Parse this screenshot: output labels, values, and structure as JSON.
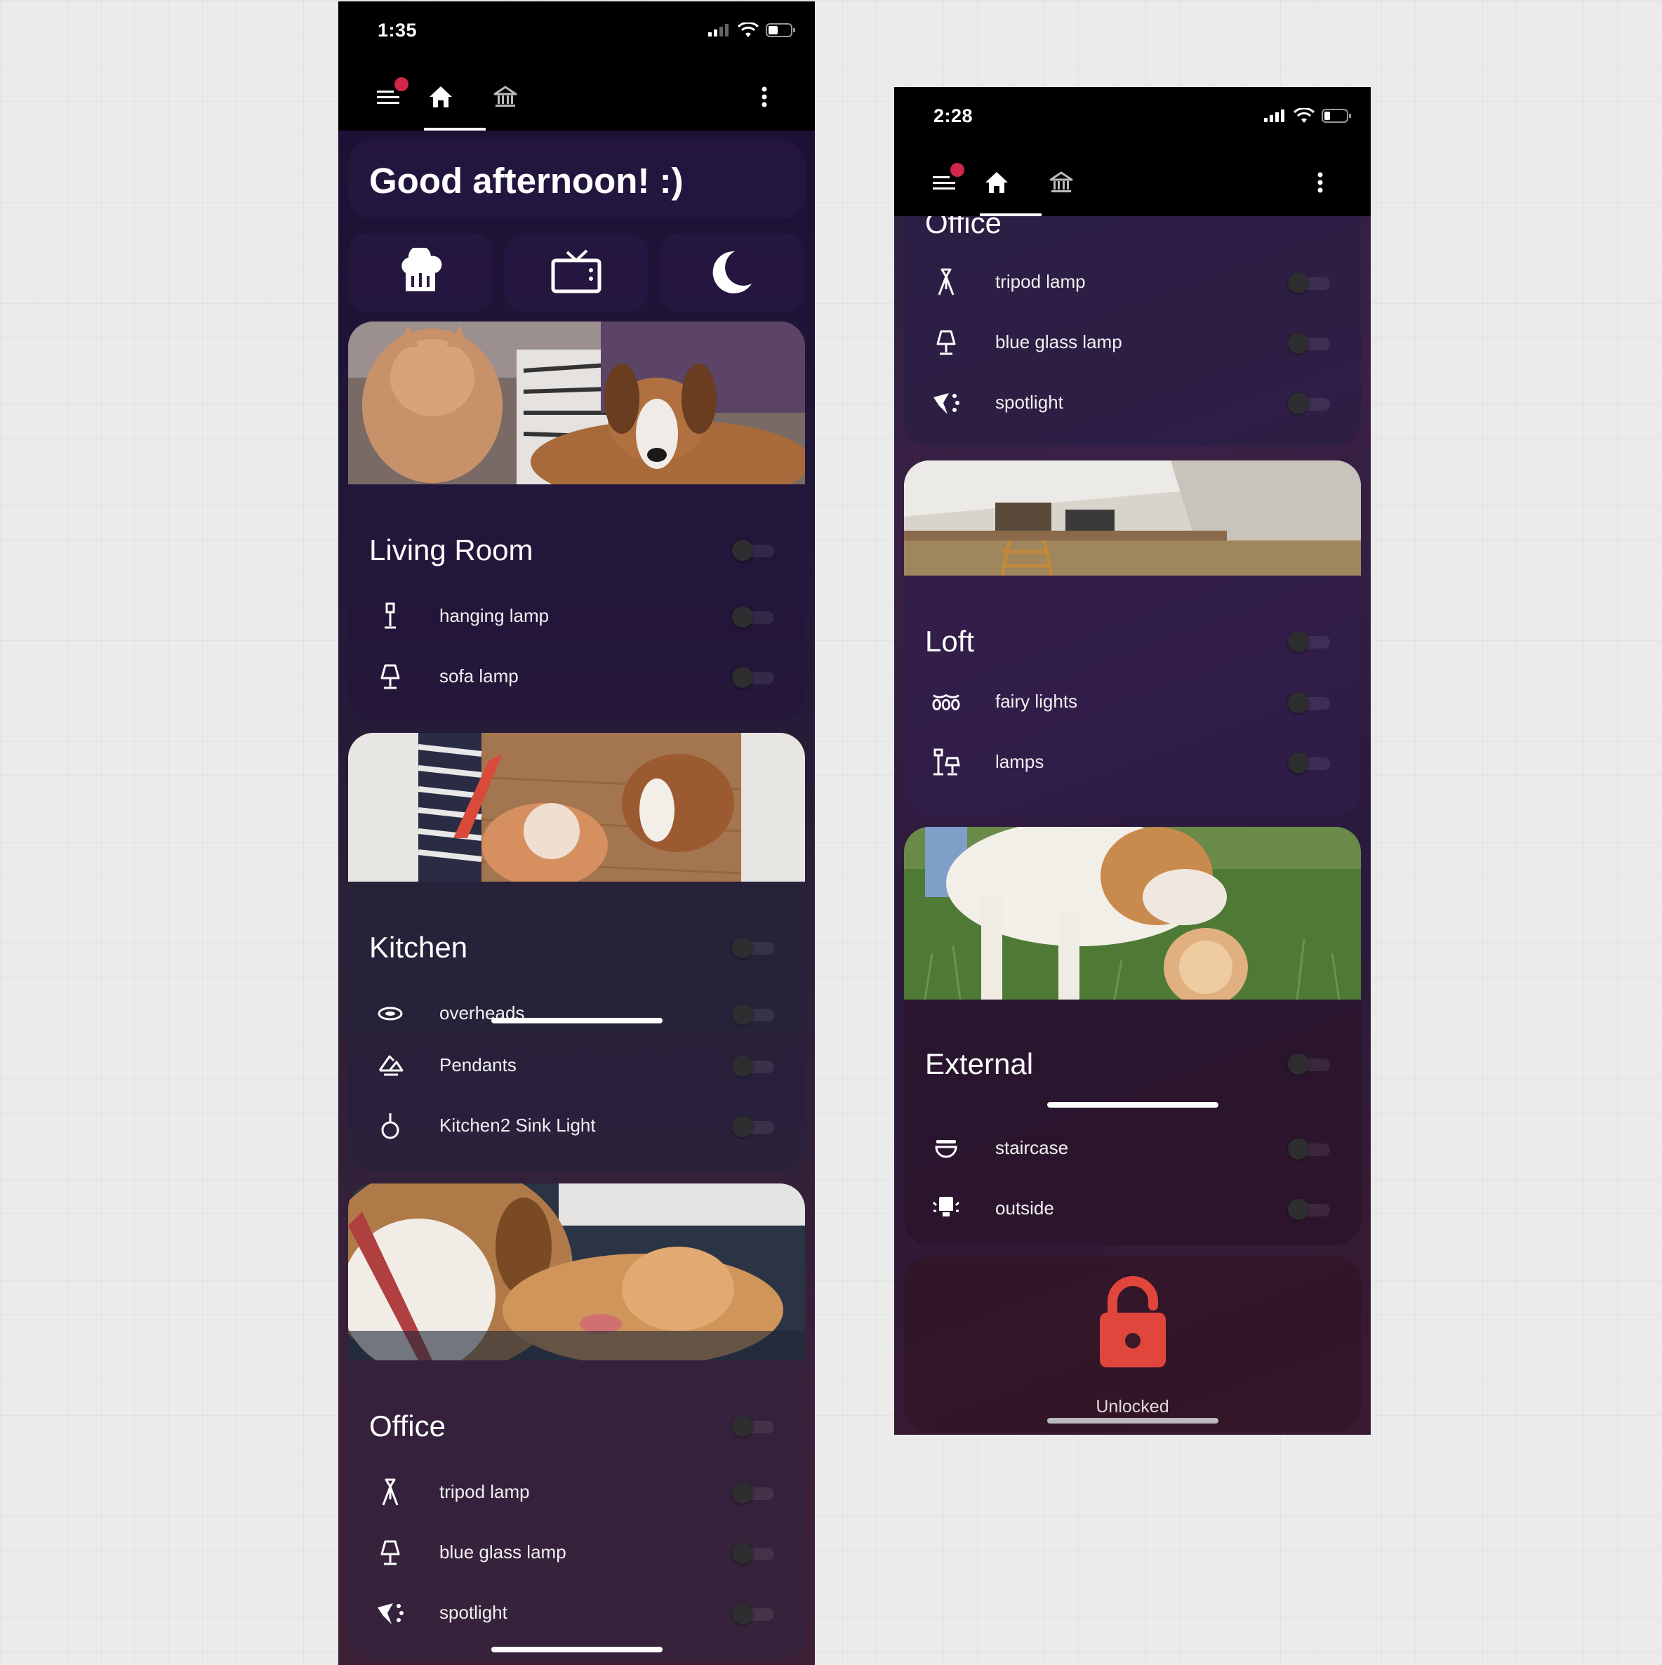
{
  "phone1": {
    "status": {
      "time": "1:35"
    },
    "greeting": "Good afternoon! :)",
    "scenes": [
      {
        "icon": "chef-hat-icon"
      },
      {
        "icon": "tv-icon"
      },
      {
        "icon": "moon-icon"
      }
    ],
    "rooms": [
      {
        "title": "Living Room",
        "items": [
          {
            "label": "hanging lamp",
            "icon": "hanging-lamp-icon"
          },
          {
            "label": "sofa lamp",
            "icon": "table-lamp-icon"
          }
        ]
      },
      {
        "title": "Kitchen",
        "items": [
          {
            "label": "overheads",
            "icon": "ceiling-light-icon"
          },
          {
            "label": "Pendants",
            "icon": "pendant-light-icon"
          },
          {
            "label": "Kitchen2 Sink Light",
            "icon": "ceiling-fixture-icon"
          }
        ]
      },
      {
        "title": "Office",
        "items": [
          {
            "label": "tripod lamp",
            "icon": "tripod-lamp-icon"
          },
          {
            "label": "blue glass lamp",
            "icon": "table-lamp-icon"
          },
          {
            "label": "spotlight",
            "icon": "spotlight-icon"
          }
        ]
      }
    ]
  },
  "phone2": {
    "status": {
      "time": "2:28"
    },
    "office_partial": {
      "title": "Office",
      "items": [
        {
          "label": "tripod lamp",
          "icon": "tripod-lamp-icon"
        },
        {
          "label": "blue glass lamp",
          "icon": "table-lamp-icon"
        },
        {
          "label": "spotlight",
          "icon": "spotlight-icon"
        }
      ]
    },
    "rooms": [
      {
        "title": "Loft",
        "items": [
          {
            "label": "fairy lights",
            "icon": "string-lights-icon"
          },
          {
            "label": "lamps",
            "icon": "floor-lamps-icon"
          }
        ]
      },
      {
        "title": "External",
        "items": [
          {
            "label": "staircase",
            "icon": "wall-light-icon"
          },
          {
            "label": "outside",
            "icon": "outdoor-light-icon"
          }
        ]
      }
    ],
    "lock": {
      "label": "Unlocked",
      "icon": "unlocked-padlock-icon",
      "color": "#e0463c"
    }
  },
  "toggles_state": "off",
  "colors": {
    "badge": "#d0264a",
    "appbar": "#000000",
    "lock": "#e0463c"
  }
}
